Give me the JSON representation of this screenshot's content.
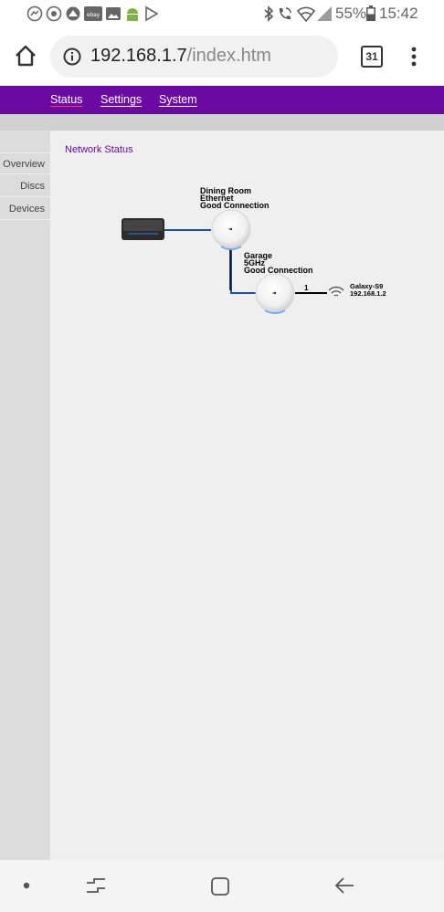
{
  "status_bar": {
    "battery_percent": "55%",
    "time": "15:42",
    "notification_icons": [
      "messenger-icon",
      "whatsapp-icon",
      "app-icon",
      "ebay-icon",
      "image-icon",
      "android-icon",
      "play-store-icon"
    ],
    "system_icons": [
      "bluetooth-icon",
      "wifi-call-icon",
      "wifi-icon",
      "signal-icon",
      "battery-icon"
    ]
  },
  "browser": {
    "url_host": "192.168.1.7",
    "url_path": "/index.htm",
    "tab_count": "31"
  },
  "top_nav": {
    "items": [
      {
        "label": "Status",
        "active": true
      },
      {
        "label": "Settings",
        "active": false
      },
      {
        "label": "System",
        "active": false
      }
    ]
  },
  "sidebar": {
    "items": [
      {
        "label": "Overview"
      },
      {
        "label": "Discs"
      },
      {
        "label": "Devices"
      }
    ]
  },
  "main": {
    "title": "Network Status",
    "nodes": [
      {
        "name": "Dining Room",
        "link": "Ethernet",
        "status": "Good Connection"
      },
      {
        "name": "Garage",
        "link": "5GHz",
        "status": "Good Connection"
      }
    ],
    "client_count": "1",
    "device": {
      "name": "Galaxy-S9",
      "ip": "192.168.1.2"
    }
  },
  "colors": {
    "accent": "#6b0aa3",
    "active_underline": "#ff3a5b",
    "link_line": "#1f4fa8"
  }
}
